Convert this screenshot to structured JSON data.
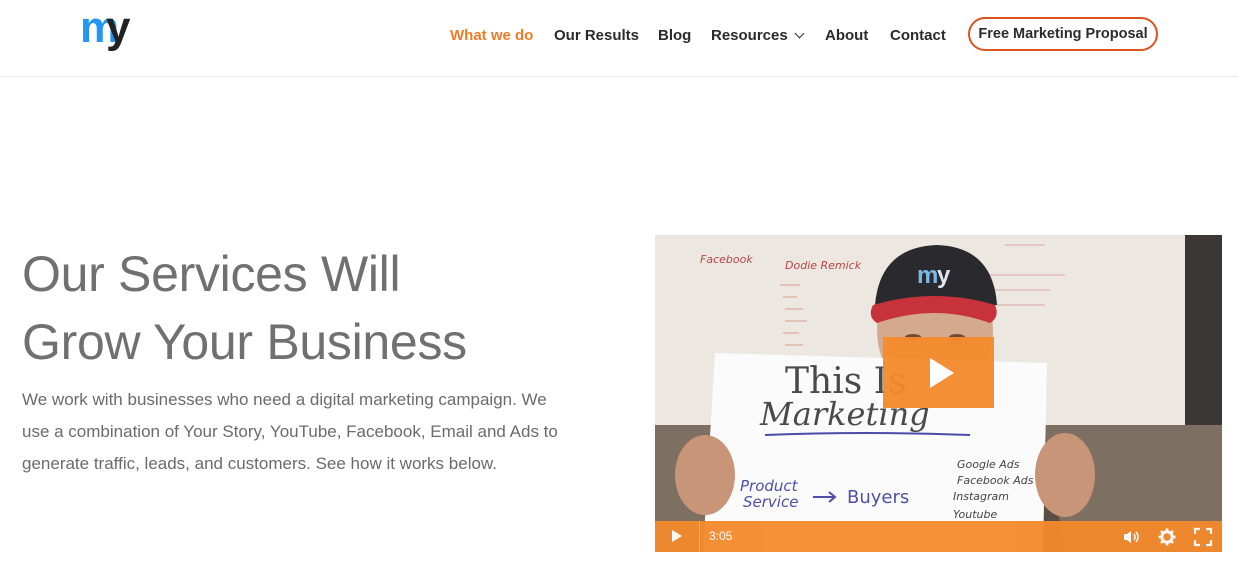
{
  "header": {
    "logo_text": "my",
    "nav": [
      {
        "label": "What we do",
        "active": true
      },
      {
        "label": "Our Results"
      },
      {
        "label": "Blog"
      },
      {
        "label": "Resources",
        "has_dropdown": true
      },
      {
        "label": "About"
      },
      {
        "label": "Contact"
      }
    ],
    "cta_label": "Free Marketing Proposal"
  },
  "hero": {
    "title_line1": "Our Services Will",
    "title_line2": "Grow Your Business",
    "body": "We work with businesses who need a digital marketing campaign. We use a combination of Your Story, YouTube, Facebook, Email and Ads to generate traffic, leads, and customers. See how it works below."
  },
  "video": {
    "duration": "3:05",
    "sign_line1": "This Is",
    "sign_line2": "Marketing",
    "sign_left_top": "Product",
    "sign_left_bottom": "Service",
    "sign_buyers": "Buyers",
    "sign_list": [
      "Google Ads",
      "Facebook Ads",
      "Instagram",
      "Youtube"
    ],
    "board_text": [
      "Dodie Remick",
      "Facebook"
    ],
    "icons": [
      "play-icon",
      "volume-icon",
      "settings-gear-icon",
      "fullscreen-icon"
    ]
  },
  "colors": {
    "accent": "#f07b27",
    "cta_border": "#d9541f",
    "video_orange": "#f58a2c",
    "title_gray": "#707070",
    "logo_blue": "#2196f3"
  }
}
